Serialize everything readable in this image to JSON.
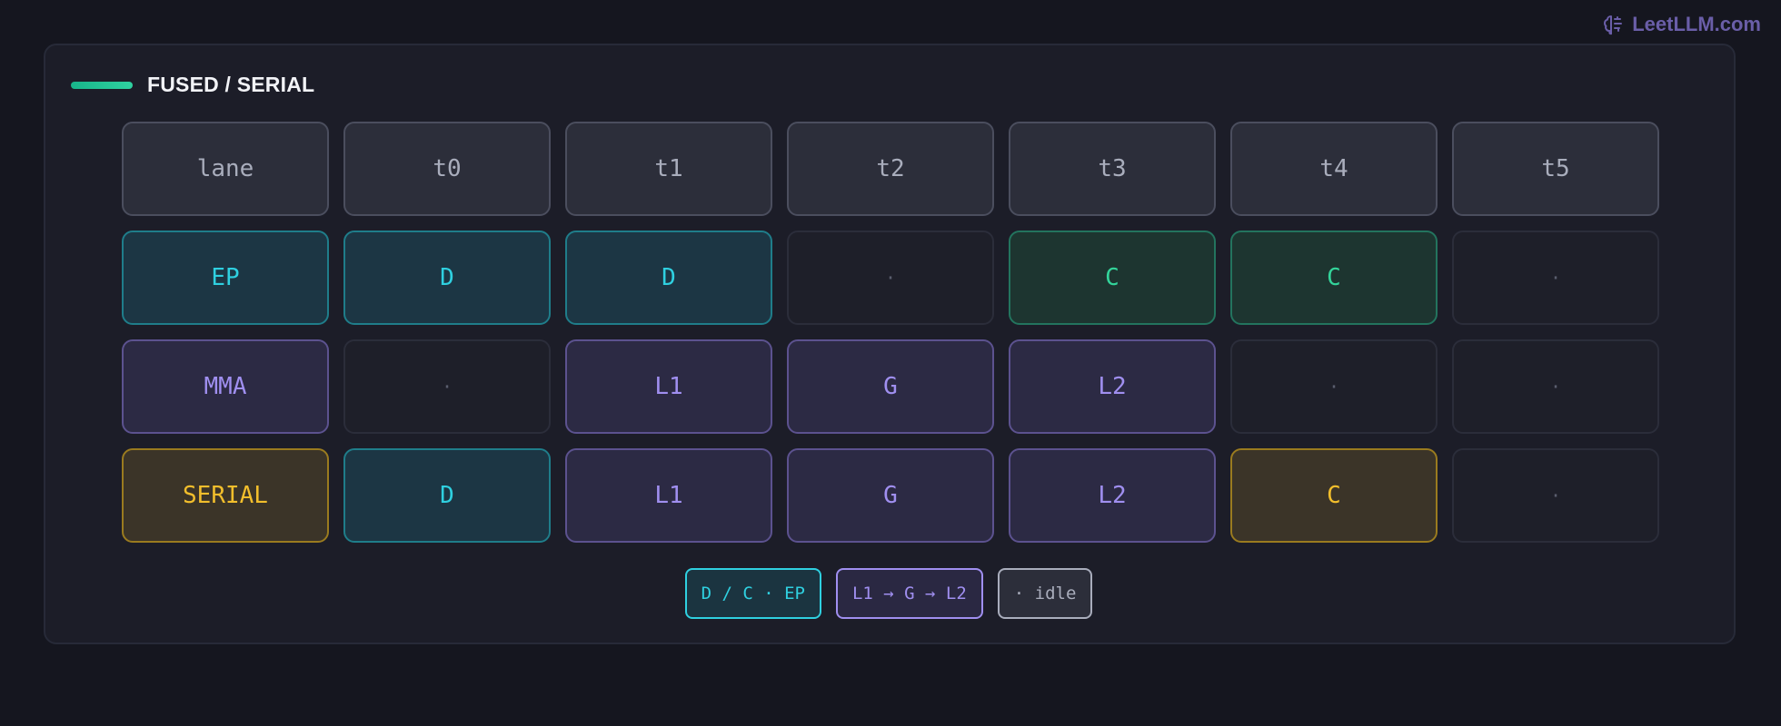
{
  "brand": {
    "text": "LeetLLM.com",
    "icon": "brain-icon",
    "color": "#6a5ea8"
  },
  "panel": {
    "title": "FUSED / SERIAL",
    "accent_color": "#2fd1a0"
  },
  "grid": {
    "header": [
      "lane",
      "t0",
      "t1",
      "t2",
      "t3",
      "t4",
      "t5"
    ],
    "rows": [
      {
        "lane": "EP",
        "lane_style": "cyan",
        "cells": [
          {
            "text": "D",
            "style": "cyan"
          },
          {
            "text": "D",
            "style": "cyan"
          },
          {
            "text": "·",
            "style": "idle"
          },
          {
            "text": "C",
            "style": "green"
          },
          {
            "text": "C",
            "style": "green"
          },
          {
            "text": "·",
            "style": "idle"
          }
        ]
      },
      {
        "lane": "MMA",
        "lane_style": "purple",
        "cells": [
          {
            "text": "·",
            "style": "idle"
          },
          {
            "text": "L1",
            "style": "purple"
          },
          {
            "text": "G",
            "style": "purple"
          },
          {
            "text": "L2",
            "style": "purple"
          },
          {
            "text": "·",
            "style": "idle"
          },
          {
            "text": "·",
            "style": "idle"
          }
        ]
      },
      {
        "lane": "SERIAL",
        "lane_style": "amber",
        "cells": [
          {
            "text": "D",
            "style": "cyan"
          },
          {
            "text": "L1",
            "style": "purple"
          },
          {
            "text": "G",
            "style": "purple"
          },
          {
            "text": "L2",
            "style": "purple"
          },
          {
            "text": "C",
            "style": "amber"
          },
          {
            "text": "·",
            "style": "idle"
          }
        ]
      }
    ]
  },
  "legend": [
    {
      "text": "D / C · EP",
      "style": "cyan"
    },
    {
      "text": "L1 → G → L2",
      "style": "purple"
    },
    {
      "text": "· idle",
      "style": "hdr"
    }
  ],
  "colors": {
    "background": "#15161f",
    "panel": "#1c1d28",
    "cyan": "#2fd0e0",
    "green": "#33d49a",
    "purple": "#a08ff0",
    "amber": "#f2be2c",
    "idle": "#5a5e6e"
  }
}
